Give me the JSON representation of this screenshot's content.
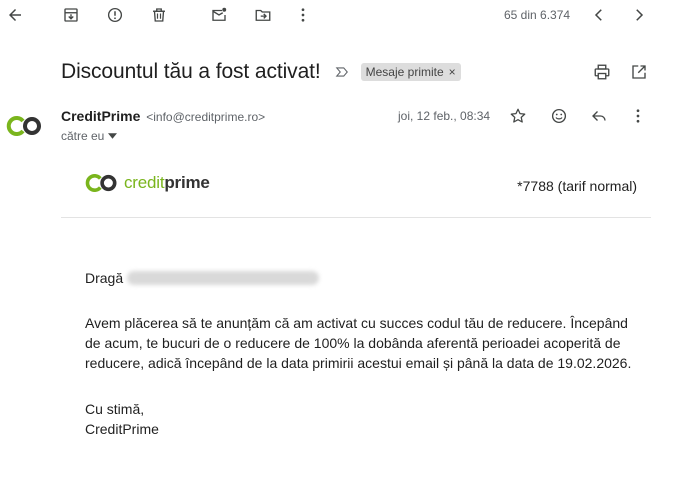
{
  "toolbar": {
    "count": "65 din 6.374",
    "icons": [
      "back-arrow-icon",
      "archive-icon",
      "report-spam-icon",
      "delete-icon",
      "mark-unread-icon",
      "move-to-icon",
      "more-vert-icon",
      "chevron-left-icon",
      "chevron-right-icon"
    ]
  },
  "email": {
    "subject": "Discountul tău a fost activat!",
    "label": "Mesaje primite",
    "label_close": "×",
    "sender_name": "CreditPrime",
    "sender_email": "<info@creditprime.ro>",
    "to": "către eu",
    "date": "joi, 12 feb., 08:34"
  },
  "body": {
    "brand_credit": "credit",
    "brand_prime": "prime",
    "account": "*7788 (tarif normal)",
    "greeting": "Dragă",
    "paragraph": "Avem plăcerea să te anunțăm că am activat cu succes codul tău de reducere. Începând de acum, te bucuri de o reducere de 100% la dobânda aferentă perioadei acoperită de reducere, adică începând de la data primirii acestui email și până la data de 19.02.2026.",
    "signoff_1": "Cu stimă,",
    "signoff_2": "CreditPrime"
  },
  "colors": {
    "brand_green": "#7ab51d",
    "brand_dark": "#333333",
    "icon_gray": "#444746"
  }
}
